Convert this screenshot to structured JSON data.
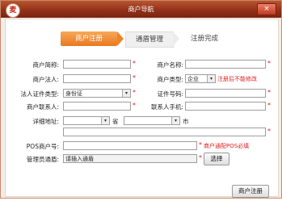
{
  "window": {
    "title": "商户导航",
    "close_label": "×",
    "logo_char": "麦"
  },
  "steps": [
    {
      "label": "商户注册"
    },
    {
      "label": "通盾管理"
    },
    {
      "label": "注册完成"
    }
  ],
  "fields": {
    "merchant_alias_label": "商户简称:",
    "merchant_name_label": "商户名称:",
    "legal_person_label": "商户法人:",
    "merchant_type_label": "商户类型:",
    "merchant_type_value": "企业",
    "merchant_type_note": "注册后不能修改",
    "id_type_label": "法人证件类型:",
    "id_type_value": "身份证",
    "id_number_label": "证件号码:",
    "contact_label": "商户联系人:",
    "contact_phone_label": "联系人手机:",
    "address_label": "详细地址:",
    "province_label": "省",
    "city_label": "市",
    "pos_label": "POS商户号:",
    "pos_note": "商户通配POS必填",
    "admin_shield_label": "管理员通盾:",
    "admin_shield_placeholder": "请插入通盾",
    "select_button": "选择"
  },
  "footer": {
    "register_button": "商户注册"
  }
}
